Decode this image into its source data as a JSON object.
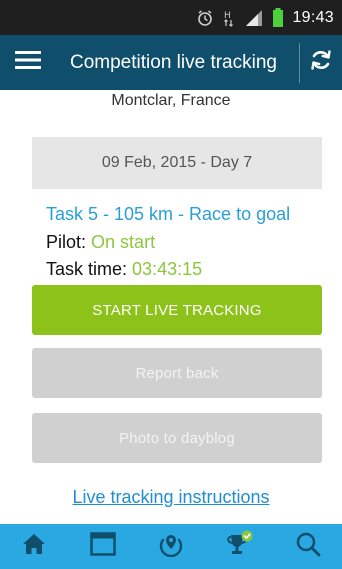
{
  "statusbar": {
    "time": "19:43",
    "icons": [
      "alarm-icon",
      "data-transfer-icon",
      "signal-icon",
      "battery-icon"
    ]
  },
  "appbar": {
    "title": "Competition live tracking",
    "menu_icon": "hamburger-menu-icon",
    "refresh_icon": "refresh-icon"
  },
  "competition": {
    "location": "Montclar, France",
    "date": "09 Feb, 2015 - Day 7"
  },
  "task": {
    "title": "Task 5 - 105 km - Race to goal",
    "pilot_label": "Pilot:",
    "pilot_status": "On start",
    "time_label": "Task time:",
    "time_value": "03:43:15"
  },
  "actions": {
    "start_label": "START LIVE TRACKING",
    "report_label": "Report back",
    "photo_label": "Photo to dayblog",
    "instructions_link": "Live tracking instructions"
  },
  "bottom_nav": {
    "items": [
      "home-icon",
      "calendar-icon",
      "location-icon",
      "trophy-icon",
      "search-icon"
    ],
    "active": "trophy-icon"
  },
  "colors": {
    "appbar": "#0f4f6c",
    "accent_blue": "#2a9fd6",
    "accent_green": "#8cc219",
    "bottom_nav": "#2aa8e1",
    "disabled": "#d0d0d0"
  }
}
